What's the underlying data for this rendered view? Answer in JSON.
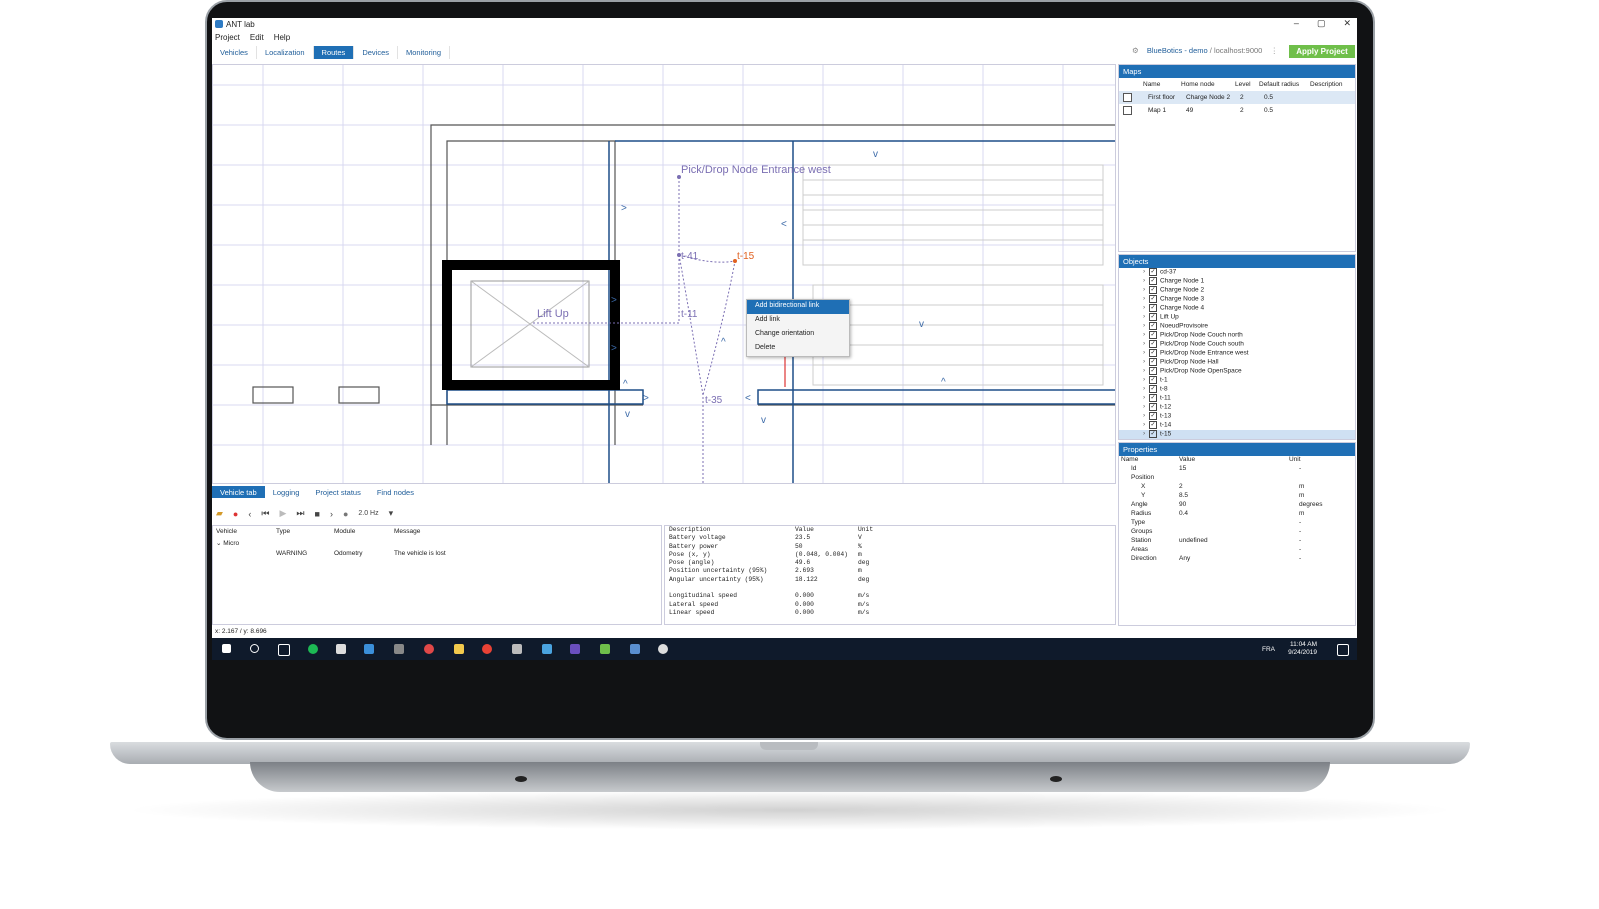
{
  "window": {
    "title": "ANT lab",
    "minimize": "–",
    "maximize": "▢",
    "close": "✕"
  },
  "menu": [
    "Project",
    "Edit",
    "Help"
  ],
  "tabs": [
    "Vehicles",
    "Localization",
    "Routes",
    "Devices",
    "Monitoring"
  ],
  "active_tab": "Routes",
  "connection": {
    "name": "BlueBotics - demo",
    "host": "/ localhost:9000"
  },
  "apply_button": "Apply Project",
  "map_labels": {
    "pick_drop": "Pick/Drop Node Entrance west",
    "lift_up": "Lift Up",
    "t41": "t-41",
    "t11": "t-11",
    "t35": "t-35",
    "t15": "t-15"
  },
  "context_menu": [
    "Add bidirectional link",
    "Add link",
    "Change orientation",
    "Delete"
  ],
  "maps_panel": {
    "title": "Maps",
    "headers": [
      "Name",
      "Home node",
      "Level",
      "Default radius",
      "Description"
    ],
    "rows": [
      {
        "name": "First floor",
        "home": "Charge Node 2",
        "level": "2",
        "radius": "0.5",
        "desc": ""
      },
      {
        "name": "Map 1",
        "home": "49",
        "level": "2",
        "radius": "0.5",
        "desc": ""
      }
    ]
  },
  "objects_panel": {
    "title": "Objects",
    "items": [
      "cd-37",
      "Charge Node 1",
      "Charge Node 2",
      "Charge Node 3",
      "Charge Node 4",
      "Lift Up",
      "NoeudProvisoire",
      "Pick/Drop Node Couch north",
      "Pick/Drop Node Couch south",
      "Pick/Drop Node Entrance west",
      "Pick/Drop Node Hall",
      "Pick/Drop Node OpenSpace",
      "t-1",
      "t-8",
      "t-11",
      "t-12",
      "t-13",
      "t-14",
      "t-15"
    ]
  },
  "properties_panel": {
    "title": "Properties",
    "headers": [
      "Name",
      "Value",
      "Unit"
    ],
    "rows": [
      {
        "n": "Id",
        "v": "15",
        "u": "-"
      },
      {
        "n": "Position",
        "v": "",
        "u": ""
      },
      {
        "n": "X",
        "v": "2",
        "u": "m"
      },
      {
        "n": "Y",
        "v": "8.5",
        "u": "m"
      },
      {
        "n": "Angle",
        "v": "90",
        "u": "degrees"
      },
      {
        "n": "Radius",
        "v": "0.4",
        "u": "m"
      },
      {
        "n": "Type",
        "v": "",
        "u": "-"
      },
      {
        "n": "Groups",
        "v": "",
        "u": "-"
      },
      {
        "n": "Station",
        "v": "undefined",
        "u": "-"
      },
      {
        "n": "Areas",
        "v": "",
        "u": "-"
      },
      {
        "n": "Direction",
        "v": "Any",
        "u": "-"
      }
    ]
  },
  "bottom_tabs": [
    "Vehicle tab",
    "Logging",
    "Project status",
    "Find nodes"
  ],
  "toolbar": {
    "rate": "2.0 Hz"
  },
  "vehicle_log": {
    "headers": [
      "Vehicle",
      "Type",
      "Module",
      "Message"
    ],
    "group": "Micro",
    "rows": [
      {
        "vehicle": "",
        "type": "WARNING",
        "module": "Odometry",
        "message": "The vehicle is lost"
      }
    ]
  },
  "diagnostics": {
    "headers": [
      "Description",
      "Value",
      "Unit"
    ],
    "rows": [
      [
        "Battery voltage",
        "23.5",
        "V"
      ],
      [
        "Battery power",
        "50",
        "%"
      ],
      [
        "Pose (x, y)",
        "(0.048, 0.004)",
        "m"
      ],
      [
        "Pose (angle)",
        "49.6",
        "deg"
      ],
      [
        "Position uncertainty (95%)",
        "2.693",
        "m"
      ],
      [
        "Angular uncertainty (95%)",
        "18.122",
        "deg"
      ],
      [
        "",
        "",
        ""
      ],
      [
        "Longitudinal speed",
        "0.000",
        "m/s"
      ],
      [
        "Lateral speed",
        "0.000",
        "m/s"
      ],
      [
        "Linear speed",
        "0.000",
        "m/s"
      ]
    ]
  },
  "status_coords": "x: 2.167 / y: 8.696",
  "taskbar": {
    "lang": "FRA",
    "time": "11:04 AM",
    "date": "9/24/2019"
  },
  "colors": {
    "accent": "#1f6fb5",
    "apply": "#6fbf4a",
    "route": "#7b6fb3",
    "taskbar": "#0f1a2b"
  }
}
